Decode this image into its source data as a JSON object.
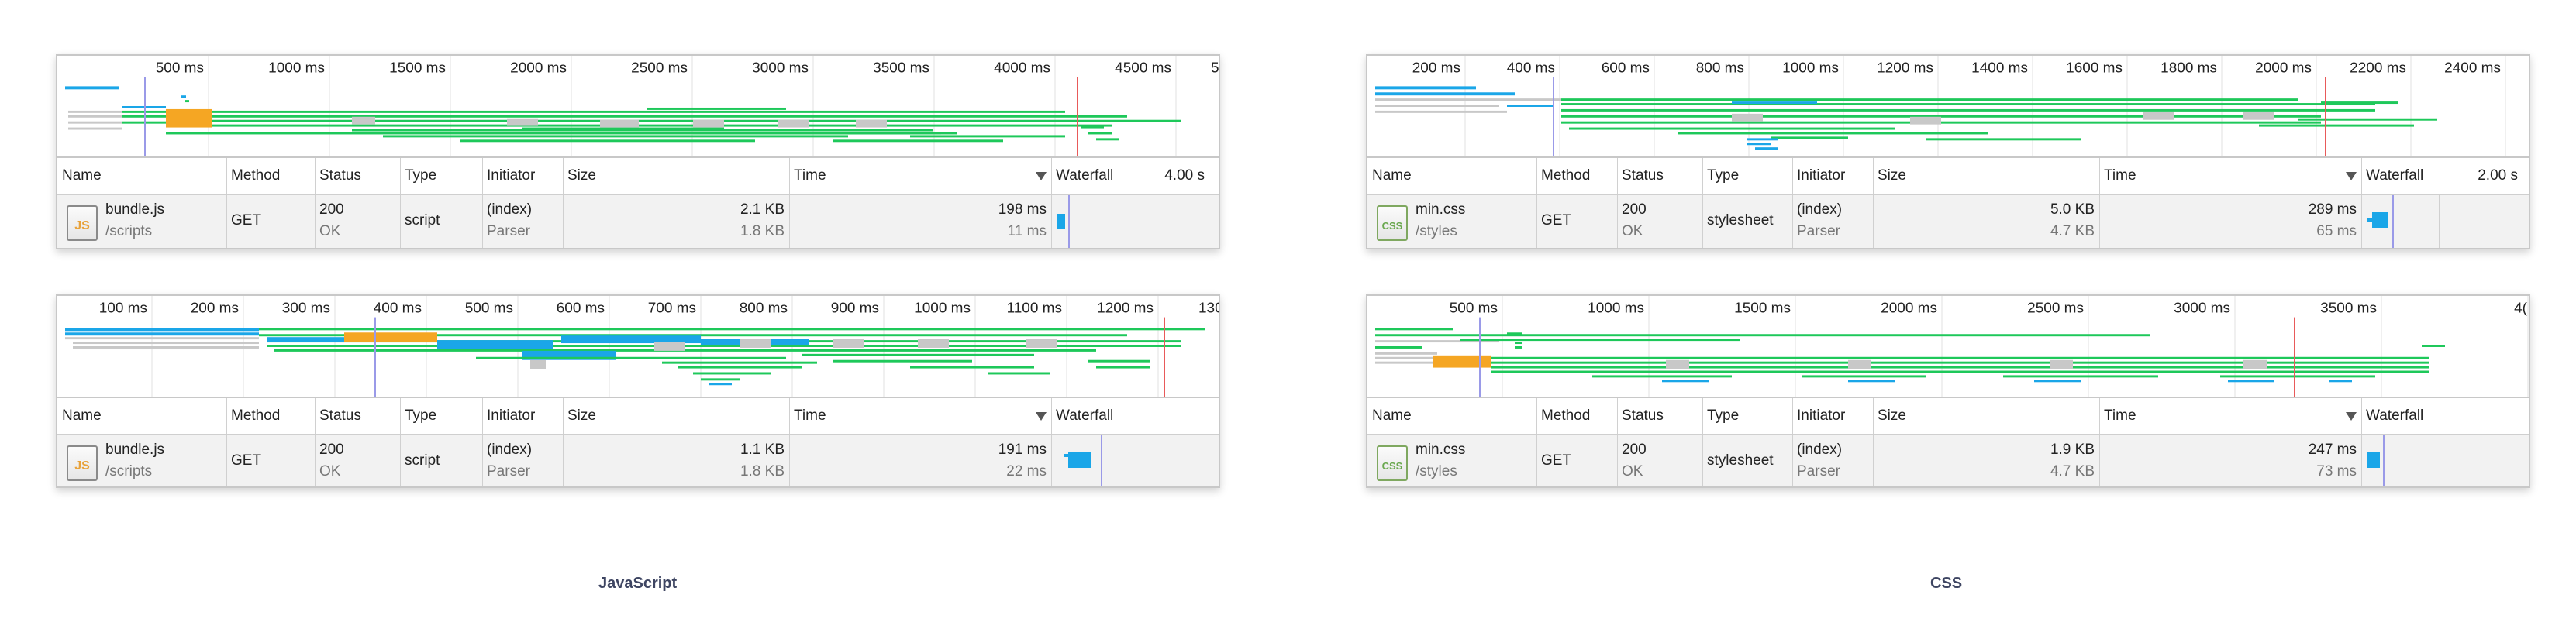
{
  "panels": [
    {
      "id": "p1",
      "ticks": [
        "500 ms",
        "1000 ms",
        "1500 ms",
        "2000 ms",
        "2500 ms",
        "3000 ms",
        "3500 ms",
        "4000 ms",
        "4500 ms",
        "5("
      ],
      "columns": [
        "Name",
        "Method",
        "Status",
        "Type",
        "Initiator",
        "Size",
        "Time",
        "Waterfall"
      ],
      "scale": "4.00 s",
      "row": {
        "icon": "js-file-icon",
        "icon_text": "JS",
        "name": "bundle.js",
        "path": "/scripts",
        "method": "GET",
        "status": "200",
        "status_text": "OK",
        "type": "script",
        "initiator": "(index)",
        "initiator_sub": "Parser",
        "size": "2.1 KB",
        "size_sub": "1.8 KB",
        "time": "198 ms",
        "time_sub": "11 ms"
      }
    },
    {
      "id": "p2",
      "ticks": [
        "200 ms",
        "400 ms",
        "600 ms",
        "800 ms",
        "1000 ms",
        "1200 ms",
        "1400 ms",
        "1600 ms",
        "1800 ms",
        "2000 ms",
        "2200 ms",
        "2400 ms"
      ],
      "columns": [
        "Name",
        "Method",
        "Status",
        "Type",
        "Initiator",
        "Size",
        "Time",
        "Waterfall"
      ],
      "scale": "2.00 s",
      "row": {
        "icon": "css-file-icon",
        "icon_text": "CSS",
        "name": "min.css",
        "path": "/styles",
        "method": "GET",
        "status": "200",
        "status_text": "OK",
        "type": "stylesheet",
        "initiator": "(index)",
        "initiator_sub": "Parser",
        "size": "5.0 KB",
        "size_sub": "4.7 KB",
        "time": "289 ms",
        "time_sub": "65 ms"
      }
    },
    {
      "id": "p3",
      "ticks": [
        "100 ms",
        "200 ms",
        "300 ms",
        "400 ms",
        "500 ms",
        "600 ms",
        "700 ms",
        "800 ms",
        "900 ms",
        "1000 ms",
        "1100 ms",
        "1200 ms",
        "130"
      ],
      "columns": [
        "Name",
        "Method",
        "Status",
        "Type",
        "Initiator",
        "Size",
        "Time",
        "Waterfall"
      ],
      "scale": "",
      "row": {
        "icon": "js-file-icon",
        "icon_text": "JS",
        "name": "bundle.js",
        "path": "/scripts",
        "method": "GET",
        "status": "200",
        "status_text": "OK",
        "type": "script",
        "initiator": "(index)",
        "initiator_sub": "Parser",
        "size": "1.1 KB",
        "size_sub": "1.8 KB",
        "time": "191 ms",
        "time_sub": "22 ms"
      }
    },
    {
      "id": "p4",
      "ticks": [
        "500 ms",
        "1000 ms",
        "1500 ms",
        "2000 ms",
        "2500 ms",
        "3000 ms",
        "3500 ms",
        "4("
      ],
      "columns": [
        "Name",
        "Method",
        "Status",
        "Type",
        "Initiator",
        "Size",
        "Time",
        "Waterfall"
      ],
      "scale": "",
      "row": {
        "icon": "css-file-icon",
        "icon_text": "CSS",
        "name": "min.css",
        "path": "/styles",
        "method": "GET",
        "status": "200",
        "status_text": "OK",
        "type": "stylesheet",
        "initiator": "(index)",
        "initiator_sub": "Parser",
        "size": "1.9 KB",
        "size_sub": "4.7 KB",
        "time": "247 ms",
        "time_sub": "73 ms"
      }
    }
  ],
  "captions": {
    "left": "JavaScript",
    "right": "CSS"
  },
  "colors": {
    "bar_green": "#1ec85a",
    "bar_blue": "#1aa6e8",
    "bar_gray": "#c8c8c8",
    "bar_orange": "#f5a623",
    "dom_line": "#9a9ae8",
    "load_line": "#e85a5a",
    "caption": "#3e4562"
  }
}
